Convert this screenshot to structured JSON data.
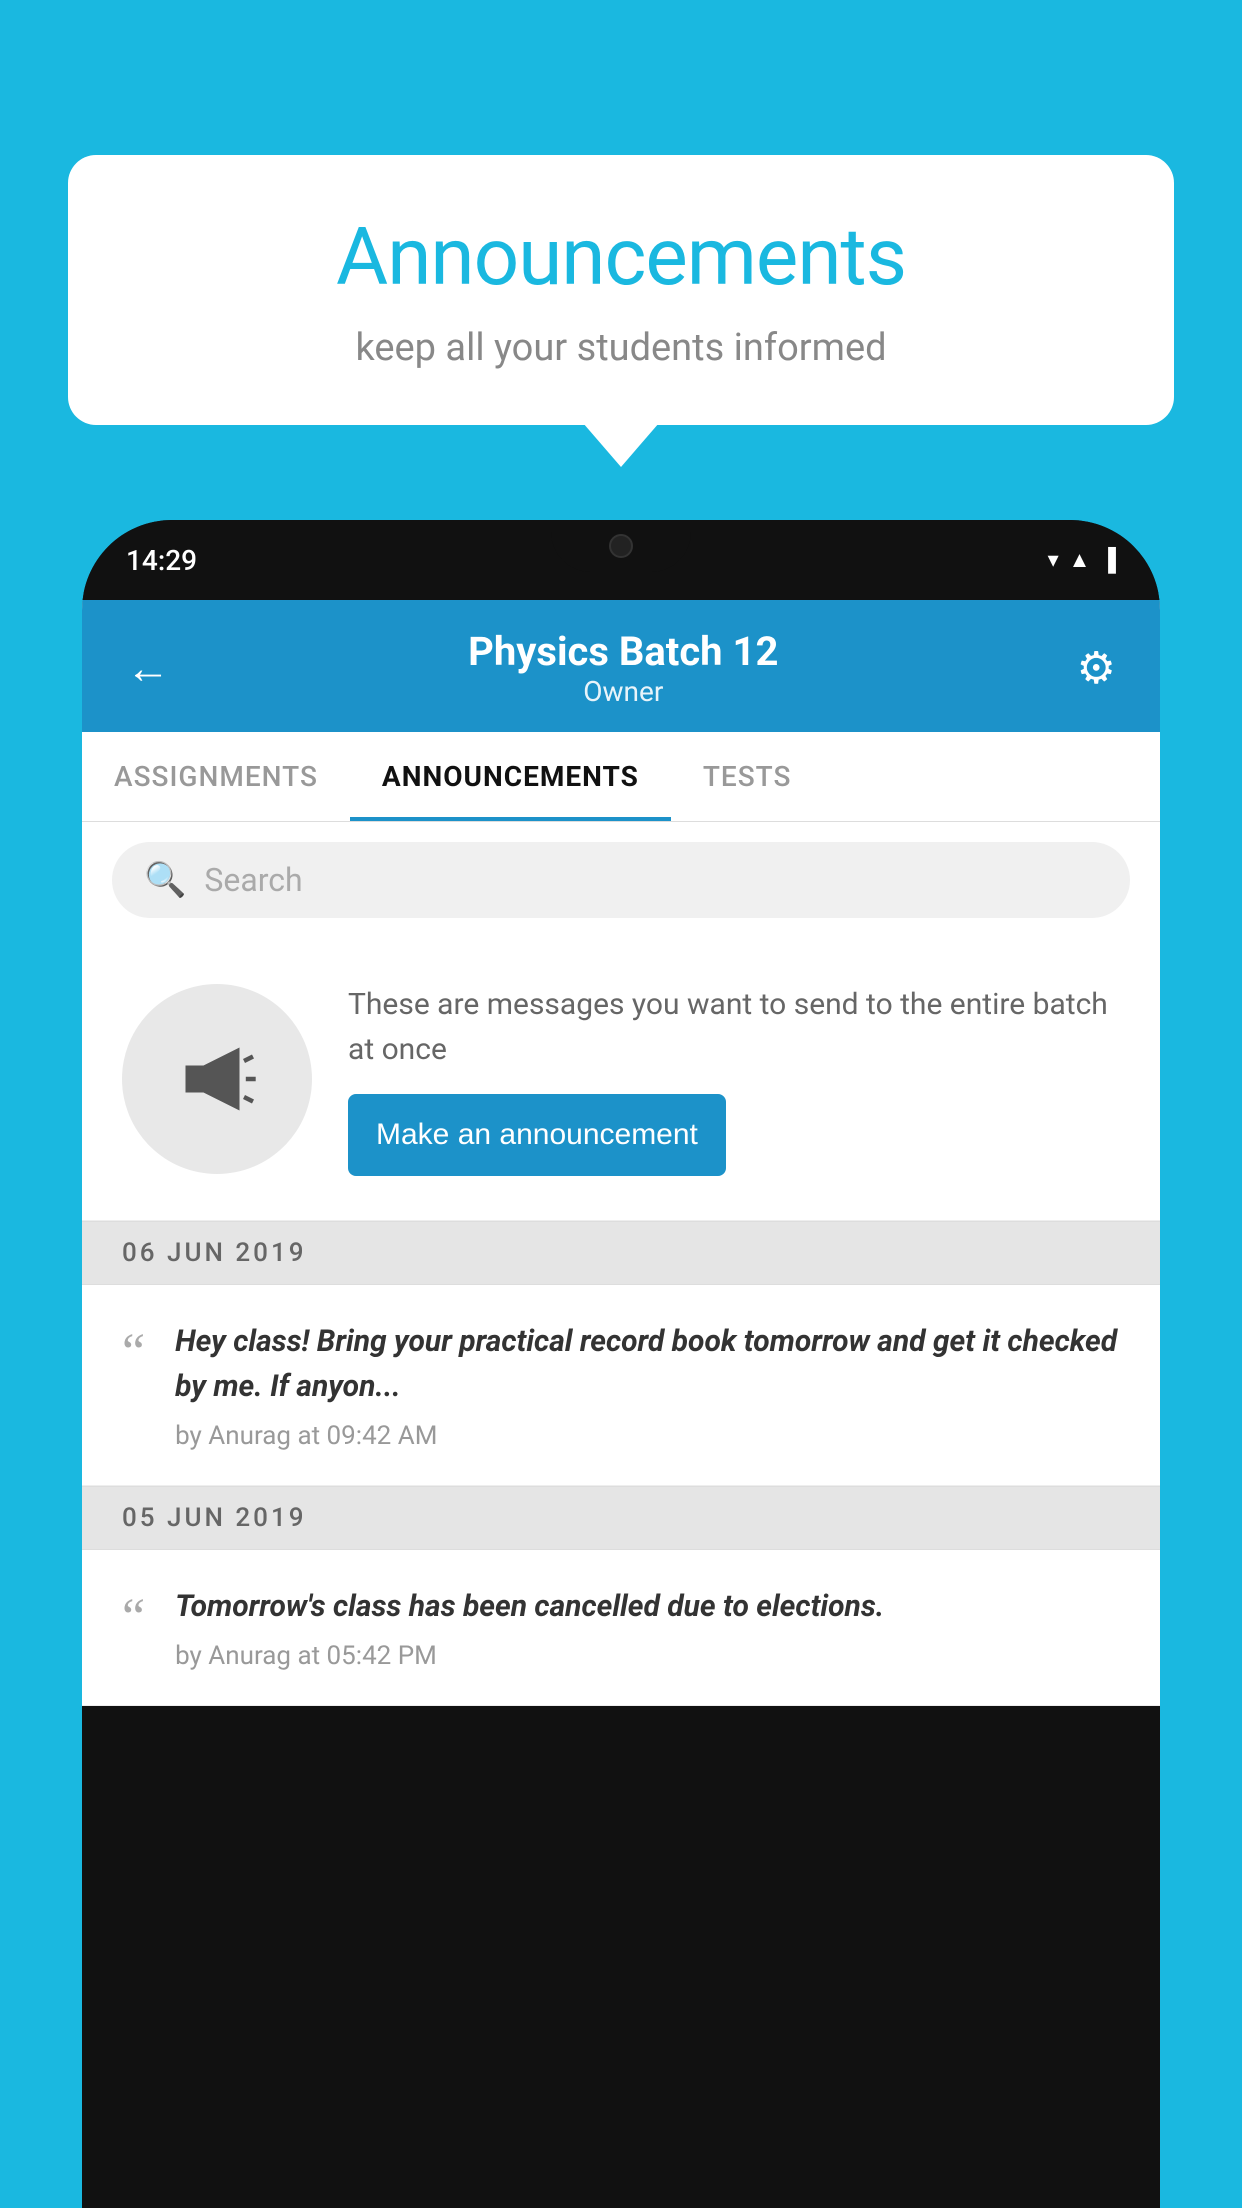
{
  "background_color": "#1ab8e0",
  "speech_bubble": {
    "title": "Announcements",
    "subtitle": "keep all your students informed"
  },
  "phone": {
    "status_bar": {
      "time": "14:29",
      "icons": "▼◀▐"
    },
    "header": {
      "title": "Physics Batch 12",
      "subtitle": "Owner",
      "back_label": "←",
      "gear_label": "⚙"
    },
    "tabs": [
      {
        "label": "ASSIGNMENTS",
        "active": false
      },
      {
        "label": "ANNOUNCEMENTS",
        "active": true
      },
      {
        "label": "TESTS",
        "active": false
      }
    ],
    "search": {
      "placeholder": "Search"
    },
    "promo": {
      "description": "These are messages you want to send to the entire batch at once",
      "button_label": "Make an announcement"
    },
    "announcement_groups": [
      {
        "date": "06  JUN  2019",
        "items": [
          {
            "message": "Hey class! Bring your practical record book tomorrow and get it checked by me. If anyon...",
            "meta": "by Anurag at 09:42 AM"
          }
        ]
      },
      {
        "date": "05  JUN  2019",
        "items": [
          {
            "message": "Tomorrow's class has been cancelled due to elections.",
            "meta": "by Anurag at 05:42 PM"
          }
        ]
      }
    ]
  }
}
